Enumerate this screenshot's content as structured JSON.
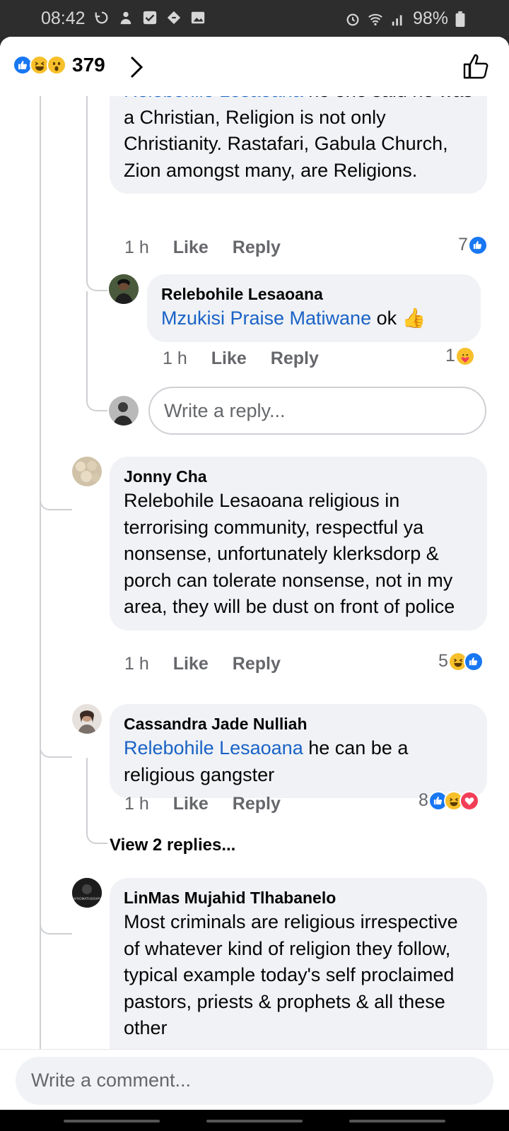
{
  "status_bar": {
    "time": "08:42",
    "battery": "98%"
  },
  "header": {
    "reaction_count": "379"
  },
  "comments": [
    {
      "mention": "Relebohile Lesaoana",
      "text": " no one said he was a Christian, Religion is not only Christianity. Rastafari, Gabula Church, Zion amongst many, are Religions.",
      "time": "1 h",
      "like": "Like",
      "reply": "Reply",
      "reaction_count": "7"
    },
    {
      "name": "Relebohile Lesaoana",
      "mention": "Mzukisi Praise Matiwane",
      "text": " ok 👍",
      "time": "1 h",
      "like": "Like",
      "reply": "Reply",
      "reaction_count": "1"
    },
    {
      "name": "Jonny Cha",
      "text": "Relebohile Lesaoana religious in terrorising community, respectful ya nonsense, unfortunately klerksdorp & porch can tolerate nonsense, not in my area, they will be dust on front of police",
      "time": "1 h",
      "like": "Like",
      "reply": "Reply",
      "reaction_count": "5"
    },
    {
      "name": "Cassandra Jade Nulliah",
      "mention": "Relebohile Lesaoana",
      "text": " he can be a religious gangster",
      "time": "1 h",
      "like": "Like",
      "reply": "Reply",
      "reaction_count": "8"
    },
    {
      "name": "LinMas Mujahid Tlhabanelo",
      "text": "Most criminals are religious irrespective of whatever kind of religion they follow, typical example today's self proclaimed pastors, priests & prophets & all these other"
    }
  ],
  "reply_placeholder": "Write a reply...",
  "view_replies": "View 2 replies...",
  "comment_placeholder": "Write a comment...",
  "avatar_labels": {
    "linmas": "AFROMATHERAPY"
  }
}
